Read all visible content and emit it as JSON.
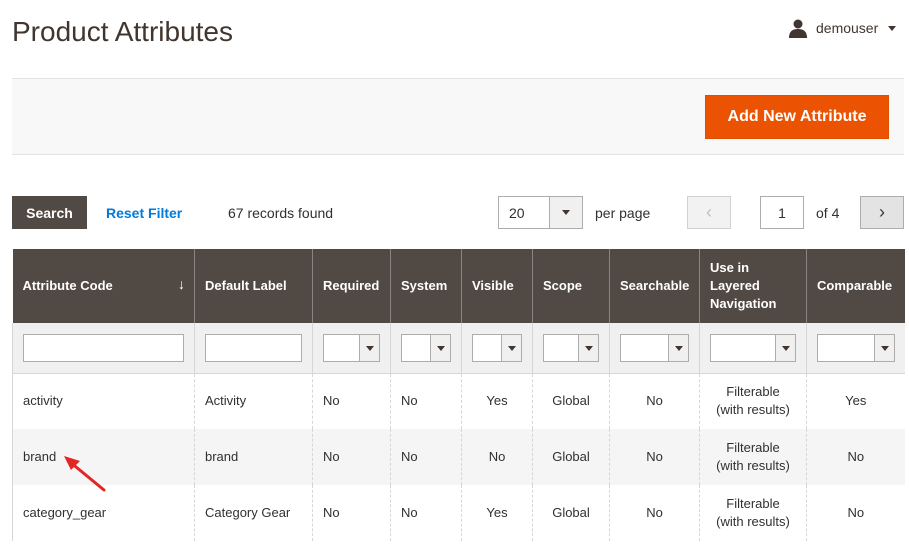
{
  "page": {
    "title": "Product Attributes"
  },
  "user": {
    "name": "demouser"
  },
  "actions": {
    "add_new": "Add New Attribute"
  },
  "toolbar": {
    "search_label": "Search",
    "reset_label": "Reset Filter",
    "records": "67 records found",
    "per_page_value": "20",
    "per_page_label": "per page",
    "current_page": "1",
    "of_pages": "of 4",
    "prev_icon": "‹",
    "next_icon": "›"
  },
  "grid": {
    "columns": [
      {
        "label": "Attribute Code",
        "sort": "↓"
      },
      {
        "label": "Default Label"
      },
      {
        "label": "Required"
      },
      {
        "label": "System"
      },
      {
        "label": "Visible"
      },
      {
        "label": "Scope"
      },
      {
        "label": "Searchable"
      },
      {
        "label": "Use in\nLayered\nNavigation"
      },
      {
        "label": "Comparable"
      }
    ],
    "rows": [
      {
        "code": "activity",
        "label": "Activity",
        "required": "No",
        "system": "No",
        "visible": "Yes",
        "scope": "Global",
        "searchable": "No",
        "layered": "Filterable\n(with results)",
        "comparable": "Yes"
      },
      {
        "code": "brand",
        "label": "brand",
        "required": "No",
        "system": "No",
        "visible": "No",
        "scope": "Global",
        "searchable": "No",
        "layered": "Filterable\n(with results)",
        "comparable": "No"
      },
      {
        "code": "category_gear",
        "label": "Category Gear",
        "required": "No",
        "system": "No",
        "visible": "Yes",
        "scope": "Global",
        "searchable": "No",
        "layered": "Filterable\n(with results)",
        "comparable": "No"
      }
    ]
  },
  "colors": {
    "accent": "#eb5202",
    "header_bg": "#514943",
    "link": "#007bdb",
    "annotation": "#e22626"
  }
}
